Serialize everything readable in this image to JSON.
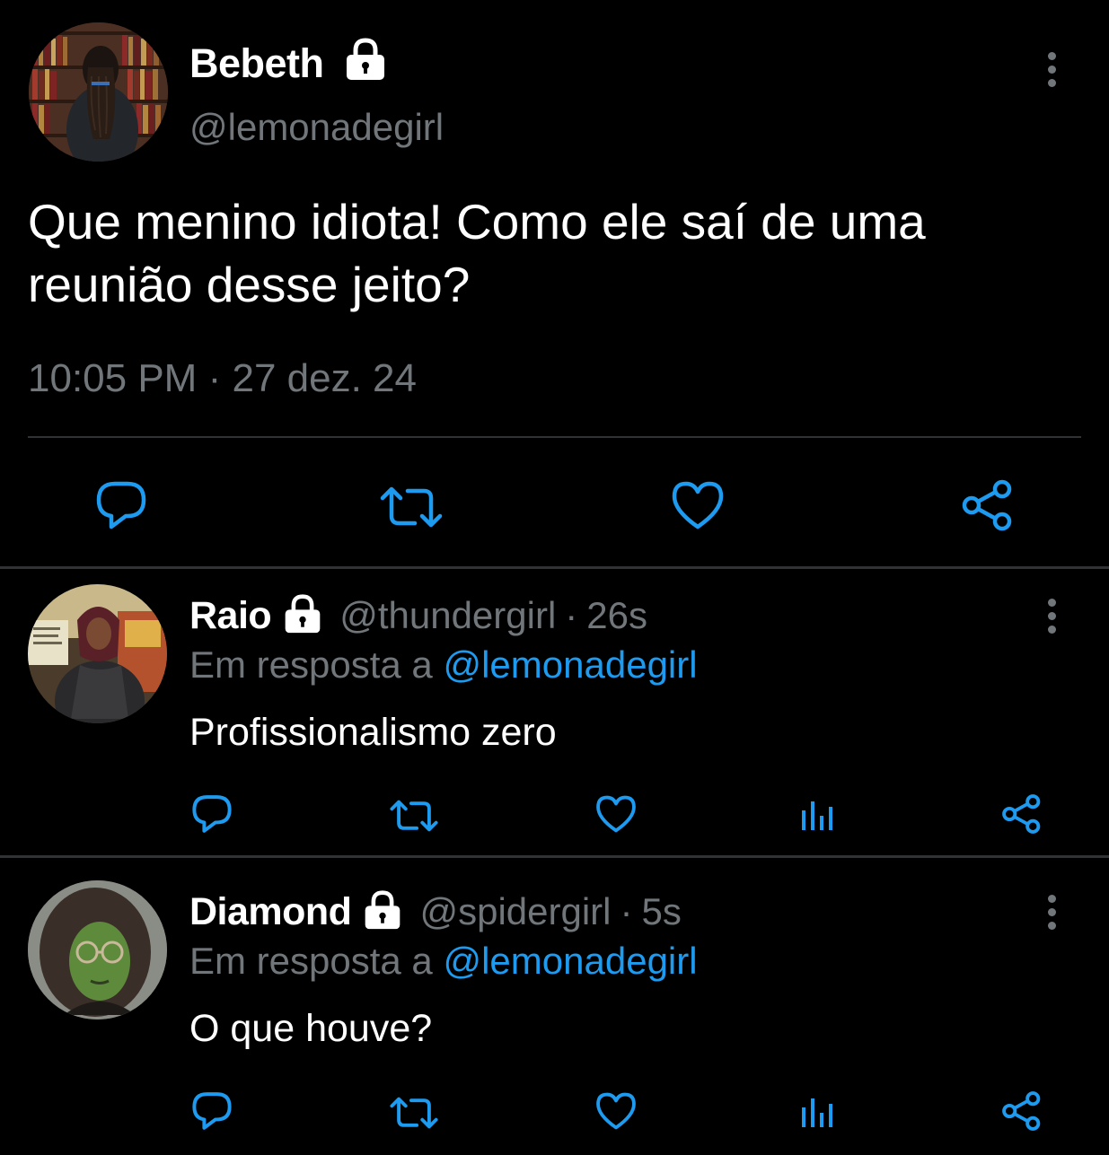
{
  "main_tweet": {
    "display_name": "Bebeth",
    "handle": "@lemonadegirl",
    "text": "Que menino idiota! Como ele saí de uma reunião desse jeito?",
    "time": "10:05 PM",
    "separator": "·",
    "date": "27 dez. 24",
    "icons": {
      "verified_lock": "lock-icon",
      "more": "more-vertical-icon",
      "reply": "reply-icon",
      "retweet": "retweet-icon",
      "like": "heart-icon",
      "share": "share-icon"
    }
  },
  "replies": [
    {
      "display_name": "Raio",
      "handle": "@thundergirl",
      "separator": "·",
      "time": "26s",
      "reply_prefix": "Em resposta a",
      "reply_mention": "@lemonadegirl",
      "text": "Profissionalismo zero"
    },
    {
      "display_name": "Diamond",
      "handle": "@spidergirl",
      "separator": "·",
      "time": "5s",
      "reply_prefix": "Em resposta a",
      "reply_mention": "@lemonadegirl",
      "text": "O que houve?"
    }
  ],
  "colors": {
    "background": "#000000",
    "primary_text": "#ffffff",
    "secondary_text": "#71767b",
    "link": "#1d9bf0",
    "divider": "#2f3336"
  }
}
